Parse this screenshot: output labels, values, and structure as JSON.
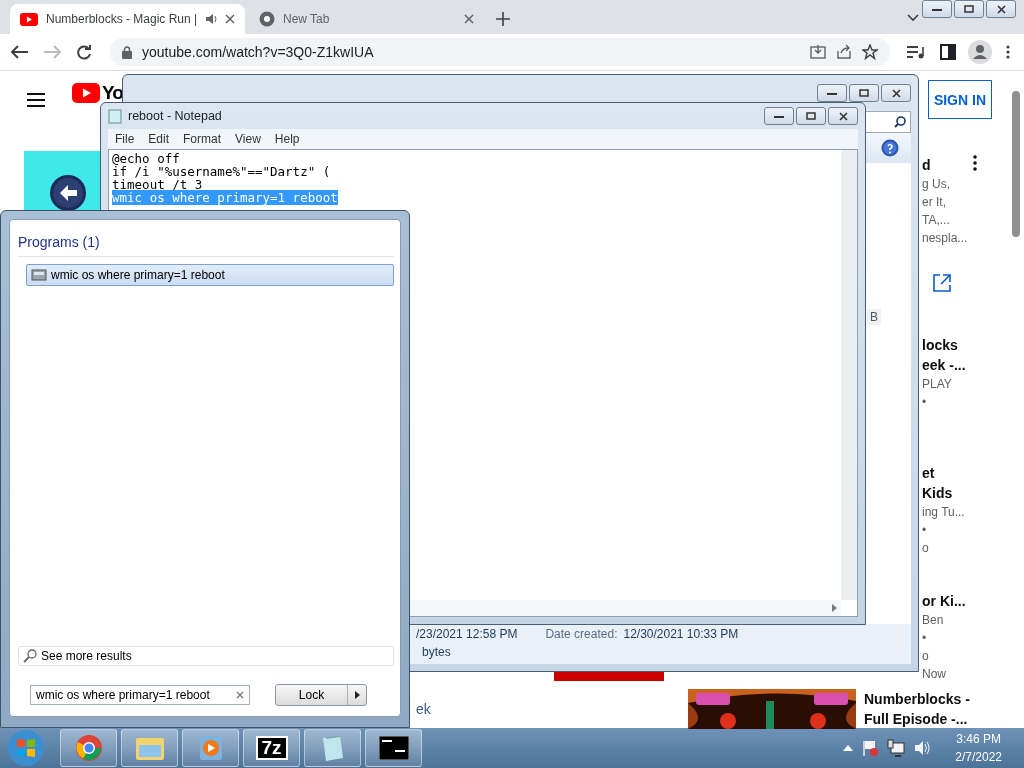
{
  "browser": {
    "tabs": [
      {
        "title": "Numberblocks - Magic Run |",
        "selected": true,
        "audio": true,
        "kind": "youtube"
      },
      {
        "title": "New Tab",
        "selected": false,
        "audio": false,
        "kind": "chrome"
      }
    ],
    "url": "youtube.com/watch?v=3Q0-Z1kwIUA",
    "forward_disabled": true
  },
  "youtube": {
    "logo_text": "Yo",
    "sign_in": "SIGN IN",
    "recommendations": [
      {
        "title": [
          "d"
        ],
        "meta": [
          "g Us,",
          "er It,",
          "TA,...",
          "nespla..."
        ]
      },
      {
        "title": [
          "locks",
          "eek -..."
        ],
        "meta": [
          "PLAY",
          "•"
        ]
      },
      {
        "title": [
          "et",
          "Kids"
        ],
        "meta": [
          "ing Tu...",
          "•",
          "o"
        ]
      },
      {
        "title": [
          "or Ki..."
        ],
        "meta": [
          "Ben",
          "•",
          "o",
          "Now"
        ]
      }
    ],
    "bottom_video": [
      "Numberblocks -",
      "Full Episode -..."
    ],
    "left_link": "ek"
  },
  "explorer": {
    "column_fragment": "B",
    "details": [
      {
        "text": "/23/2021 12:58 PM"
      },
      {
        "label": "Date created:",
        "text": "12/30/2021 10:33 PM"
      },
      {
        "text": "bytes"
      }
    ]
  },
  "notepad": {
    "title": "reboot - Notepad",
    "menu": [
      "File",
      "Edit",
      "Format",
      "View",
      "Help"
    ],
    "lines": [
      {
        "text": "@echo off",
        "selected": false
      },
      {
        "text": "if /i \"%username%\"==\"Dartz\" (",
        "selected": false
      },
      {
        "text": "timeout /t 3",
        "selected": false
      },
      {
        "text": "wmic os where primary=1 reboot",
        "selected": true
      }
    ]
  },
  "start_menu": {
    "group_heading": "Programs (1)",
    "results": [
      {
        "label": "wmic os where primary=1 reboot",
        "selected": true
      }
    ],
    "see_more": "See more results",
    "search": {
      "value": "wmic os where primary=1 reboot"
    },
    "power_button": "Lock"
  },
  "taskbar": {
    "apps": [
      {
        "kind": "chrome"
      },
      {
        "kind": "explorer"
      },
      {
        "kind": "media"
      },
      {
        "kind": "sevenzip",
        "label": "7z"
      },
      {
        "kind": "notepad"
      },
      {
        "kind": "cmd"
      }
    ],
    "clock": {
      "time": "3:46 PM",
      "date": "2/7/2022"
    }
  }
}
